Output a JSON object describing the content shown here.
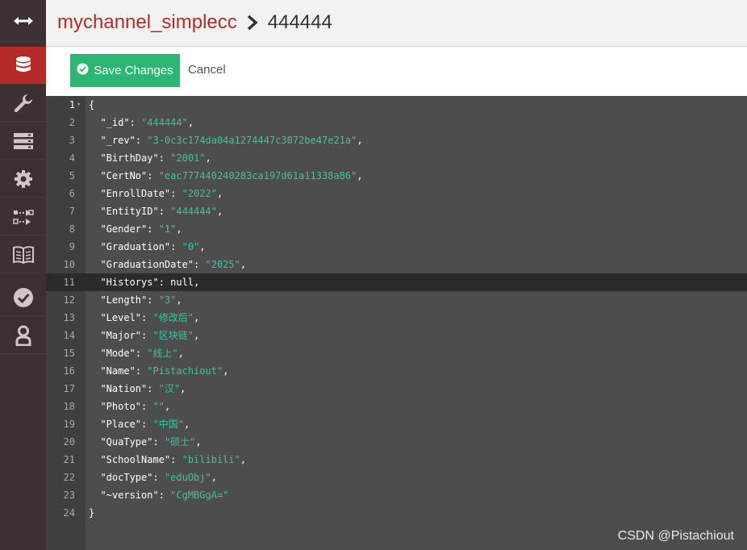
{
  "sidebar": {
    "items": [
      {
        "icon": "collapse-arrows-icon"
      },
      {
        "icon": "database-icon",
        "active": true
      },
      {
        "icon": "wrench-icon"
      },
      {
        "icon": "server-icon"
      },
      {
        "icon": "gear-icon"
      },
      {
        "icon": "replication-icon"
      },
      {
        "icon": "book-icon"
      },
      {
        "icon": "check-circle-icon"
      },
      {
        "icon": "user-icon"
      }
    ]
  },
  "header": {
    "database": "mychannel_simplecc",
    "document": "444444"
  },
  "toolbar": {
    "save_label": "Save Changes",
    "cancel_label": "Cancel"
  },
  "editor": {
    "active_line": 11,
    "lines": [
      {
        "n": "1",
        "text": "{"
      },
      {
        "n": "2",
        "key": "\"_id\"",
        "val": "\"444444\"",
        "end": ","
      },
      {
        "n": "3",
        "key": "\"_rev\"",
        "val": "\"3-0c3c174da04a1274447c3072be47e21a\"",
        "end": ","
      },
      {
        "n": "4",
        "key": "\"BirthDay\"",
        "val": "\"2001\"",
        "end": ","
      },
      {
        "n": "5",
        "key": "\"CertNo\"",
        "val": "\"eac777440240283ca197d61a11338a86\"",
        "end": ","
      },
      {
        "n": "6",
        "key": "\"EnrollDate\"",
        "val": "\"2022\"",
        "end": ","
      },
      {
        "n": "7",
        "key": "\"EntityID\"",
        "val": "\"444444\"",
        "end": ","
      },
      {
        "n": "8",
        "key": "\"Gender\"",
        "val": "\"1\"",
        "end": ","
      },
      {
        "n": "9",
        "key": "\"Graduation\"",
        "val": "\"0\"",
        "end": ","
      },
      {
        "n": "10",
        "key": "\"GraduationDate\"",
        "val": "\"2025\"",
        "end": ","
      },
      {
        "n": "11",
        "key": "\"Historys\"",
        "plain": "null",
        "end": ","
      },
      {
        "n": "12",
        "key": "\"Length\"",
        "val": "\"3\"",
        "end": ","
      },
      {
        "n": "13",
        "key": "\"Level\"",
        "val": "\"修改后\"",
        "end": ","
      },
      {
        "n": "14",
        "key": "\"Major\"",
        "val": "\"区块链\"",
        "end": ","
      },
      {
        "n": "15",
        "key": "\"Mode\"",
        "val": "\"线上\"",
        "end": ","
      },
      {
        "n": "16",
        "key": "\"Name\"",
        "val": "\"Pistachiout\"",
        "end": ","
      },
      {
        "n": "17",
        "key": "\"Nation\"",
        "val": "\"汉\"",
        "end": ","
      },
      {
        "n": "18",
        "key": "\"Photo\"",
        "val": "\"\"",
        "end": ","
      },
      {
        "n": "19",
        "key": "\"Place\"",
        "val": "\"中国\"",
        "end": ","
      },
      {
        "n": "20",
        "key": "\"QuaType\"",
        "val": "\"硕士\"",
        "end": ","
      },
      {
        "n": "21",
        "key": "\"SchoolName\"",
        "val": "\"bilibili\"",
        "end": ","
      },
      {
        "n": "22",
        "key": "\"docType\"",
        "val": "\"eduObj\"",
        "end": ","
      },
      {
        "n": "23",
        "key": "\"~version\"",
        "val": "\"CgMBGgA=\"",
        "end": ""
      },
      {
        "n": "24",
        "text": "}"
      }
    ]
  },
  "watermark": "CSDN @Pistachiout"
}
